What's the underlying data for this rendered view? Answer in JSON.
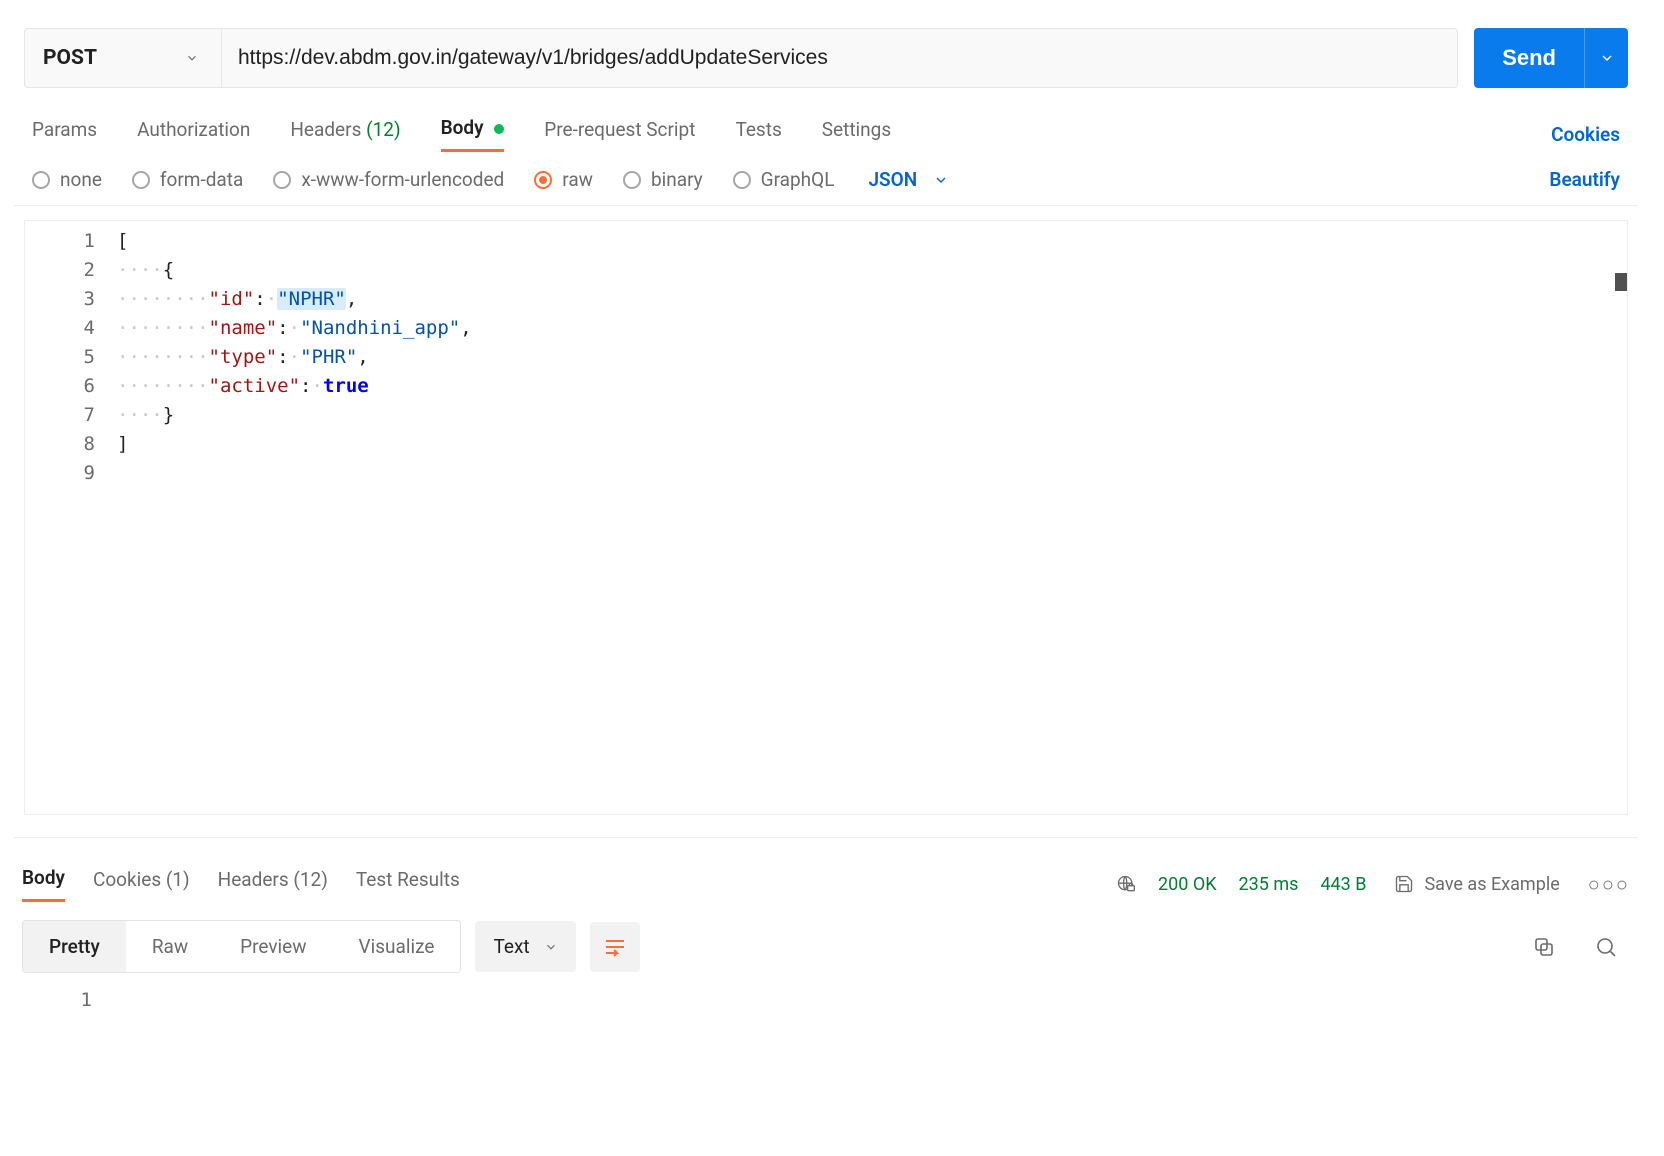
{
  "request": {
    "method": "POST",
    "url": "https://dev.abdm.gov.in/gateway/v1/bridges/addUpdateServices",
    "send_label": "Send"
  },
  "req_tabs": {
    "params": "Params",
    "authorization": "Authorization",
    "headers_label": "Headers",
    "headers_count": "(12)",
    "body": "Body",
    "prerequest": "Pre-request Script",
    "tests": "Tests",
    "settings": "Settings",
    "cookies": "Cookies"
  },
  "body_types": {
    "none": "none",
    "form_data": "form-data",
    "x_www": "x-www-form-urlencoded",
    "raw": "raw",
    "binary": "binary",
    "graphql": "GraphQL",
    "json_label": "JSON",
    "beautify": "Beautify"
  },
  "editor": {
    "lines": [
      "1",
      "2",
      "3",
      "4",
      "5",
      "6",
      "7",
      "8",
      "9"
    ],
    "json_payload": [
      {
        "id": "NPHR",
        "name": "Nandhini_app",
        "type": "PHR",
        "active": true
      }
    ],
    "keys": {
      "id": "\"id\"",
      "name": "\"name\"",
      "type": "\"type\"",
      "active": "\"active\""
    },
    "vals": {
      "id": "\"NPHR\"",
      "name": "\"Nandhini_app\"",
      "type": "\"PHR\"",
      "active": "true"
    }
  },
  "response": {
    "tabs": {
      "body": "Body",
      "cookies_label": "Cookies",
      "cookies_count": "(1)",
      "headers_label": "Headers",
      "headers_count": "(12)",
      "test_results": "Test Results"
    },
    "status": "200 OK",
    "time": "235 ms",
    "size": "443 B",
    "save_example": "Save as Example",
    "view_modes": {
      "pretty": "Pretty",
      "raw": "Raw",
      "preview": "Preview",
      "visualize": "Visualize"
    },
    "content_type": "Text",
    "body_lines": [
      "1"
    ]
  }
}
